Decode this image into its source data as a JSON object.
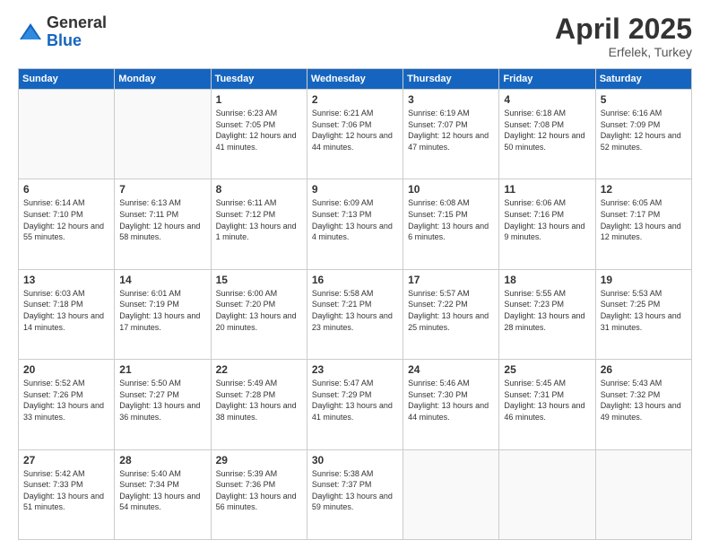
{
  "logo": {
    "general": "General",
    "blue": "Blue"
  },
  "header": {
    "month": "April 2025",
    "location": "Erfelek, Turkey"
  },
  "weekdays": [
    "Sunday",
    "Monday",
    "Tuesday",
    "Wednesday",
    "Thursday",
    "Friday",
    "Saturday"
  ],
  "weeks": [
    [
      {
        "day": "",
        "sunrise": "",
        "sunset": "",
        "daylight": ""
      },
      {
        "day": "",
        "sunrise": "",
        "sunset": "",
        "daylight": ""
      },
      {
        "day": "1",
        "sunrise": "Sunrise: 6:23 AM",
        "sunset": "Sunset: 7:05 PM",
        "daylight": "Daylight: 12 hours and 41 minutes."
      },
      {
        "day": "2",
        "sunrise": "Sunrise: 6:21 AM",
        "sunset": "Sunset: 7:06 PM",
        "daylight": "Daylight: 12 hours and 44 minutes."
      },
      {
        "day": "3",
        "sunrise": "Sunrise: 6:19 AM",
        "sunset": "Sunset: 7:07 PM",
        "daylight": "Daylight: 12 hours and 47 minutes."
      },
      {
        "day": "4",
        "sunrise": "Sunrise: 6:18 AM",
        "sunset": "Sunset: 7:08 PM",
        "daylight": "Daylight: 12 hours and 50 minutes."
      },
      {
        "day": "5",
        "sunrise": "Sunrise: 6:16 AM",
        "sunset": "Sunset: 7:09 PM",
        "daylight": "Daylight: 12 hours and 52 minutes."
      }
    ],
    [
      {
        "day": "6",
        "sunrise": "Sunrise: 6:14 AM",
        "sunset": "Sunset: 7:10 PM",
        "daylight": "Daylight: 12 hours and 55 minutes."
      },
      {
        "day": "7",
        "sunrise": "Sunrise: 6:13 AM",
        "sunset": "Sunset: 7:11 PM",
        "daylight": "Daylight: 12 hours and 58 minutes."
      },
      {
        "day": "8",
        "sunrise": "Sunrise: 6:11 AM",
        "sunset": "Sunset: 7:12 PM",
        "daylight": "Daylight: 13 hours and 1 minute."
      },
      {
        "day": "9",
        "sunrise": "Sunrise: 6:09 AM",
        "sunset": "Sunset: 7:13 PM",
        "daylight": "Daylight: 13 hours and 4 minutes."
      },
      {
        "day": "10",
        "sunrise": "Sunrise: 6:08 AM",
        "sunset": "Sunset: 7:15 PM",
        "daylight": "Daylight: 13 hours and 6 minutes."
      },
      {
        "day": "11",
        "sunrise": "Sunrise: 6:06 AM",
        "sunset": "Sunset: 7:16 PM",
        "daylight": "Daylight: 13 hours and 9 minutes."
      },
      {
        "day": "12",
        "sunrise": "Sunrise: 6:05 AM",
        "sunset": "Sunset: 7:17 PM",
        "daylight": "Daylight: 13 hours and 12 minutes."
      }
    ],
    [
      {
        "day": "13",
        "sunrise": "Sunrise: 6:03 AM",
        "sunset": "Sunset: 7:18 PM",
        "daylight": "Daylight: 13 hours and 14 minutes."
      },
      {
        "day": "14",
        "sunrise": "Sunrise: 6:01 AM",
        "sunset": "Sunset: 7:19 PM",
        "daylight": "Daylight: 13 hours and 17 minutes."
      },
      {
        "day": "15",
        "sunrise": "Sunrise: 6:00 AM",
        "sunset": "Sunset: 7:20 PM",
        "daylight": "Daylight: 13 hours and 20 minutes."
      },
      {
        "day": "16",
        "sunrise": "Sunrise: 5:58 AM",
        "sunset": "Sunset: 7:21 PM",
        "daylight": "Daylight: 13 hours and 23 minutes."
      },
      {
        "day": "17",
        "sunrise": "Sunrise: 5:57 AM",
        "sunset": "Sunset: 7:22 PM",
        "daylight": "Daylight: 13 hours and 25 minutes."
      },
      {
        "day": "18",
        "sunrise": "Sunrise: 5:55 AM",
        "sunset": "Sunset: 7:23 PM",
        "daylight": "Daylight: 13 hours and 28 minutes."
      },
      {
        "day": "19",
        "sunrise": "Sunrise: 5:53 AM",
        "sunset": "Sunset: 7:25 PM",
        "daylight": "Daylight: 13 hours and 31 minutes."
      }
    ],
    [
      {
        "day": "20",
        "sunrise": "Sunrise: 5:52 AM",
        "sunset": "Sunset: 7:26 PM",
        "daylight": "Daylight: 13 hours and 33 minutes."
      },
      {
        "day": "21",
        "sunrise": "Sunrise: 5:50 AM",
        "sunset": "Sunset: 7:27 PM",
        "daylight": "Daylight: 13 hours and 36 minutes."
      },
      {
        "day": "22",
        "sunrise": "Sunrise: 5:49 AM",
        "sunset": "Sunset: 7:28 PM",
        "daylight": "Daylight: 13 hours and 38 minutes."
      },
      {
        "day": "23",
        "sunrise": "Sunrise: 5:47 AM",
        "sunset": "Sunset: 7:29 PM",
        "daylight": "Daylight: 13 hours and 41 minutes."
      },
      {
        "day": "24",
        "sunrise": "Sunrise: 5:46 AM",
        "sunset": "Sunset: 7:30 PM",
        "daylight": "Daylight: 13 hours and 44 minutes."
      },
      {
        "day": "25",
        "sunrise": "Sunrise: 5:45 AM",
        "sunset": "Sunset: 7:31 PM",
        "daylight": "Daylight: 13 hours and 46 minutes."
      },
      {
        "day": "26",
        "sunrise": "Sunrise: 5:43 AM",
        "sunset": "Sunset: 7:32 PM",
        "daylight": "Daylight: 13 hours and 49 minutes."
      }
    ],
    [
      {
        "day": "27",
        "sunrise": "Sunrise: 5:42 AM",
        "sunset": "Sunset: 7:33 PM",
        "daylight": "Daylight: 13 hours and 51 minutes."
      },
      {
        "day": "28",
        "sunrise": "Sunrise: 5:40 AM",
        "sunset": "Sunset: 7:34 PM",
        "daylight": "Daylight: 13 hours and 54 minutes."
      },
      {
        "day": "29",
        "sunrise": "Sunrise: 5:39 AM",
        "sunset": "Sunset: 7:36 PM",
        "daylight": "Daylight: 13 hours and 56 minutes."
      },
      {
        "day": "30",
        "sunrise": "Sunrise: 5:38 AM",
        "sunset": "Sunset: 7:37 PM",
        "daylight": "Daylight: 13 hours and 59 minutes."
      },
      {
        "day": "",
        "sunrise": "",
        "sunset": "",
        "daylight": ""
      },
      {
        "day": "",
        "sunrise": "",
        "sunset": "",
        "daylight": ""
      },
      {
        "day": "",
        "sunrise": "",
        "sunset": "",
        "daylight": ""
      }
    ]
  ]
}
